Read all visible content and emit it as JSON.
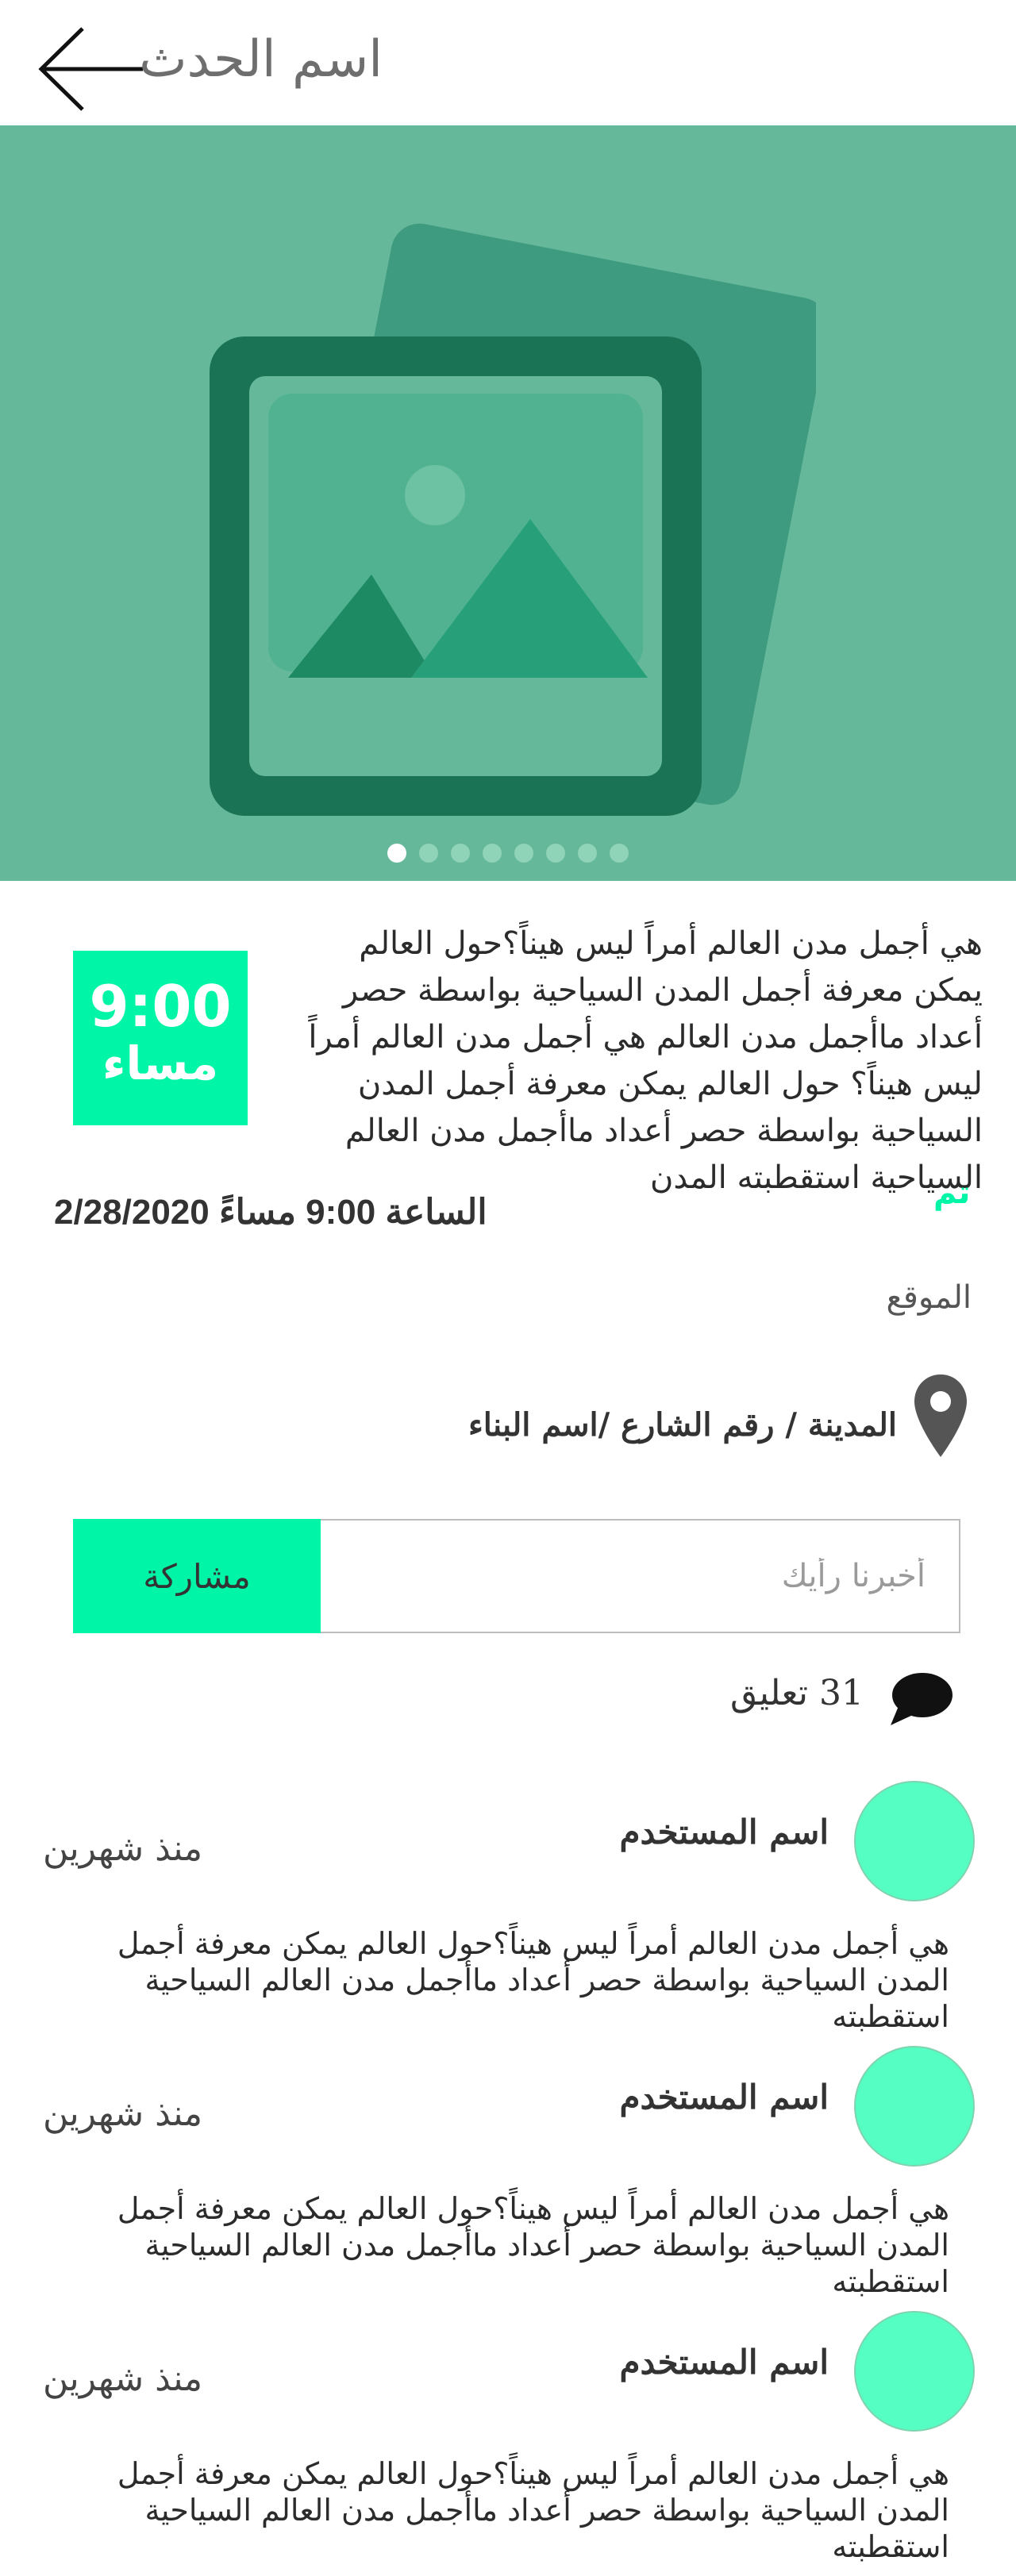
{
  "header": {
    "title": "اسم الحدث",
    "back_icon": "arrow-left-icon"
  },
  "hero": {
    "background_color": "#65b99a",
    "image_icon": "image-placeholder-icon",
    "slide_count": 8,
    "active_slide": 1
  },
  "event": {
    "time_value": "9:00",
    "time_period": "مساء",
    "description": "هي أجمل مدن العالم أمراً ليس هيناً؟حول العالم  يمكن معرفة أجمل المدن السياحية بواسطة حصر أعداد ماأجمل مدن العالم هي أجمل مدن العالم أمراً ليس هيناً؟ حول العالم  يمكن معرفة أجمل المدن السياحية بواسطة حصر أعداد ماأجمل مدن العالم السياحية استقطبته المدن",
    "status": "تم",
    "datetime": "الساعة 9:00 مساءً 2/28/2020",
    "location_label": "الموقع",
    "address": "المدينة / رقم  الشارع /اسم البناء",
    "accent_color": "#00f5a6"
  },
  "comment_form": {
    "placeholder": "أخبرنا رأيك",
    "share_label": "مشاركة"
  },
  "comments_header": {
    "count_text": "31 تعليق",
    "icon": "speech-bubble-icon"
  },
  "comments": [
    {
      "name": "اسم المستخدم",
      "time": "منذ شهرين",
      "text": "هي أجمل مدن العالم أمراً ليس هيناً؟حول العالم  يمكن معرفة أجمل المدن السياحية بواسطة حصر أعداد ماأجمل مدن العالم السياحية استقطبته"
    },
    {
      "name": "اسم المستخدم",
      "time": "منذ شهرين",
      "text": "هي أجمل مدن العالم أمراً ليس هيناً؟حول العالم  يمكن معرفة أجمل المدن السياحية بواسطة حصر أعداد ماأجمل مدن العالم السياحية استقطبته"
    },
    {
      "name": "اسم المستخدم",
      "time": "منذ شهرين",
      "text": "هي أجمل مدن العالم أمراً ليس هيناً؟حول العالم  يمكن معرفة أجمل المدن السياحية بواسطة حصر أعداد ماأجمل مدن العالم السياحية استقطبته"
    }
  ]
}
